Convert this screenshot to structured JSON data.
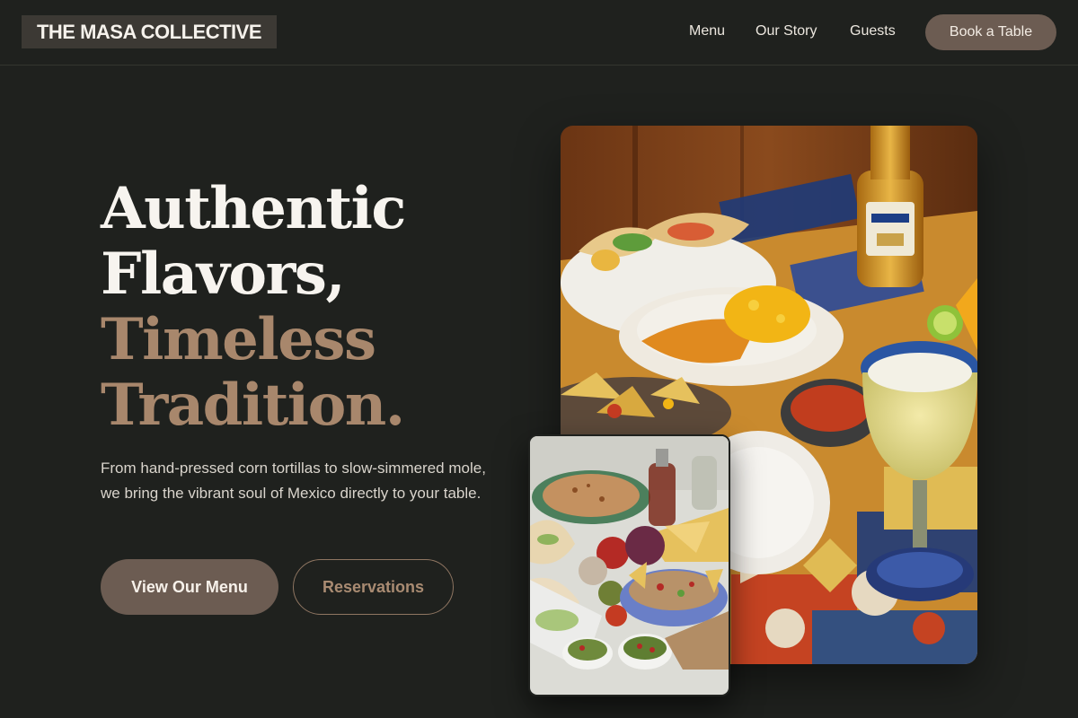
{
  "header": {
    "logo": "THE MASA COLLECTIVE",
    "nav": [
      "Menu",
      "Our Story",
      "Guests"
    ],
    "cta": "Book a Table"
  },
  "hero": {
    "headline": [
      "Authentic",
      "Flavors,",
      "Timeless",
      "Tradition."
    ],
    "subtext": "From hand-pressed corn tortillas to slow-simmered mole, we bring the vibrant soul of Mexico directly to your table.",
    "primary_button": "View Our Menu",
    "secondary_button": "Reservations"
  },
  "images": {
    "main": "photo-of-tacos-margarita-beer-table",
    "secondary": "photo-of-quesadilla-salsas-guacamole-spread"
  },
  "colors": {
    "background": "#1f211e",
    "accent_brown": "#6c5c52",
    "accent_tan": "#a8876c",
    "text_light": "#f7f4ef"
  }
}
